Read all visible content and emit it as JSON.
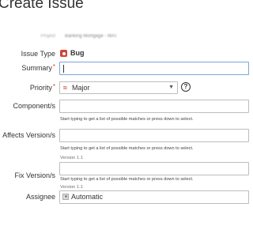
{
  "dialog": {
    "title": "Create Issue"
  },
  "project": {
    "label": "Project",
    "value": "Banking Mortgage - MAT"
  },
  "issue_type": {
    "label": "Issue Type",
    "required": "*",
    "value": "Bug",
    "icon": "bug-icon"
  },
  "summary": {
    "label": "Summary",
    "required": "*",
    "value": ""
  },
  "priority": {
    "label": "Priority",
    "required": "*",
    "icon_glyph": "≈",
    "value": "Major",
    "arrow": "▼",
    "help_glyph": "?"
  },
  "components": {
    "label": "Component/s",
    "hint": "Start typing to get a list of possible matches or press down to select."
  },
  "affects_version": {
    "label": "Affects Version/s",
    "hint": "Start typing to get a list of possible matches or press down to select.",
    "note": "Version 1.1"
  },
  "fix_version": {
    "label": "Fix Version/s",
    "hint": "Start typing to get a list of possible matches or press down to select.",
    "note": "Version 1.1"
  },
  "assignee": {
    "label": "Assignee",
    "value": "Automatic"
  },
  "colors": {
    "required_marker": "#d04437",
    "bug_icon": "#d04437",
    "priority_icon": "#d04437",
    "focused_border": "#7aa7d9"
  }
}
